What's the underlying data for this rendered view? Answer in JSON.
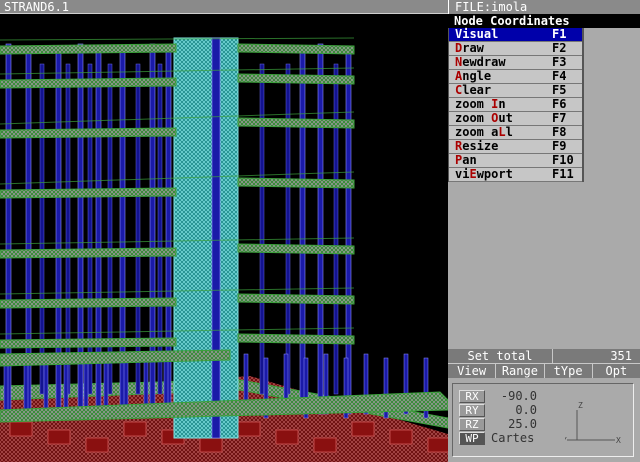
{
  "window": {
    "title": "STRAND6.1"
  },
  "file": {
    "label": "FILE:imola"
  },
  "panel": {
    "title": "Node Coordinates"
  },
  "menu": [
    {
      "hot": "V",
      "rest": "isual",
      "pre": "",
      "key": "F1",
      "active": true
    },
    {
      "hot": "D",
      "rest": "raw",
      "pre": "",
      "key": "F2"
    },
    {
      "hot": "N",
      "rest": "ewdraw",
      "pre": "",
      "key": "F3"
    },
    {
      "hot": "A",
      "rest": "ngle",
      "pre": "",
      "key": "F4"
    },
    {
      "hot": "C",
      "rest": "lear",
      "pre": "",
      "key": "F5"
    },
    {
      "pre": "zoom ",
      "hot": "I",
      "rest": "n",
      "key": "F6"
    },
    {
      "pre": "zoom ",
      "hot": "O",
      "rest": "ut",
      "key": "F7"
    },
    {
      "pre": "zoom a",
      "hot": "L",
      "rest": "l",
      "key": "F8"
    },
    {
      "pre": "",
      "hot": "R",
      "rest": "esize",
      "key": "F9"
    },
    {
      "pre": "",
      "hot": "P",
      "rest": "an",
      "key": "F10"
    },
    {
      "pre": "vi",
      "hot": "E",
      "rest": "wport",
      "key": "F11"
    }
  ],
  "set_total": {
    "label": "Set total",
    "value": "351"
  },
  "tabs": [
    "View",
    "Range",
    "tYpe",
    "Opt"
  ],
  "view": {
    "rx": {
      "label": "RX",
      "value": "-90.0"
    },
    "ry": {
      "label": "RY",
      "value": "0.0"
    },
    "rz": {
      "label": "RZ",
      "value": "25.0"
    },
    "wp": {
      "label": "WP",
      "value": "Cartes"
    },
    "axes": {
      "z": "Z",
      "y": "Y",
      "x": "X"
    }
  },
  "colors": {
    "column": "#1a1aa8",
    "slab": "#3ca03c",
    "core": "#2aa0a0",
    "foundation": "#8a1010"
  }
}
